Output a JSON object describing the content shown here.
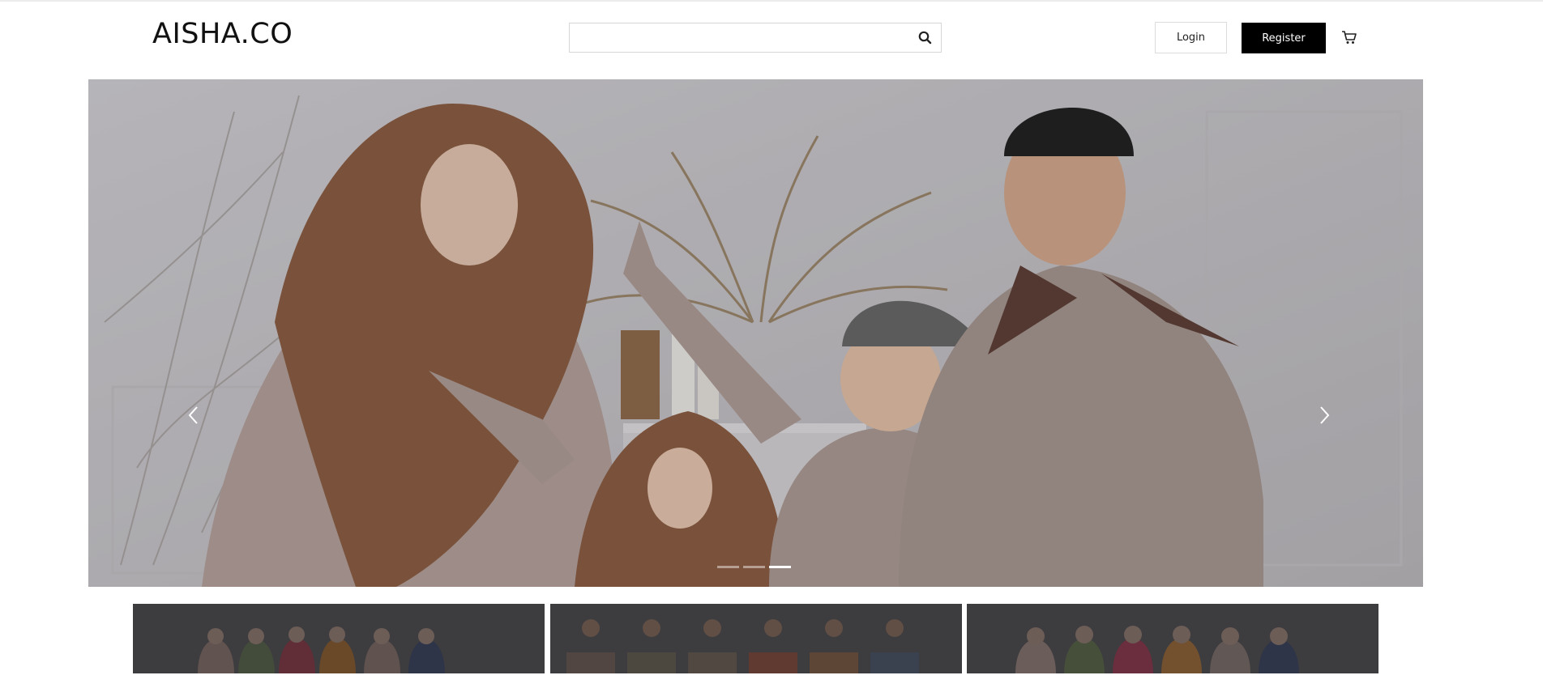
{
  "header": {
    "brand": "AISHA.CO",
    "search": {
      "value": "",
      "placeholder": ""
    },
    "login_label": "Login",
    "register_label": "Register",
    "icons": {
      "search": "search-icon",
      "cart": "cart-icon"
    }
  },
  "hero": {
    "slide_count": 3,
    "active_slide": 3,
    "icons": {
      "prev": "chevron-left-icon",
      "next": "chevron-right-icon"
    }
  },
  "categories": [
    {
      "name": "category-women"
    },
    {
      "name": "category-men"
    },
    {
      "name": "category-kids"
    }
  ],
  "colors": {
    "primary": "#000000",
    "hero_overlay": "#3b3b3d",
    "hijab_brown": "#8b5a3c",
    "robe_taupe": "#a8978f"
  }
}
